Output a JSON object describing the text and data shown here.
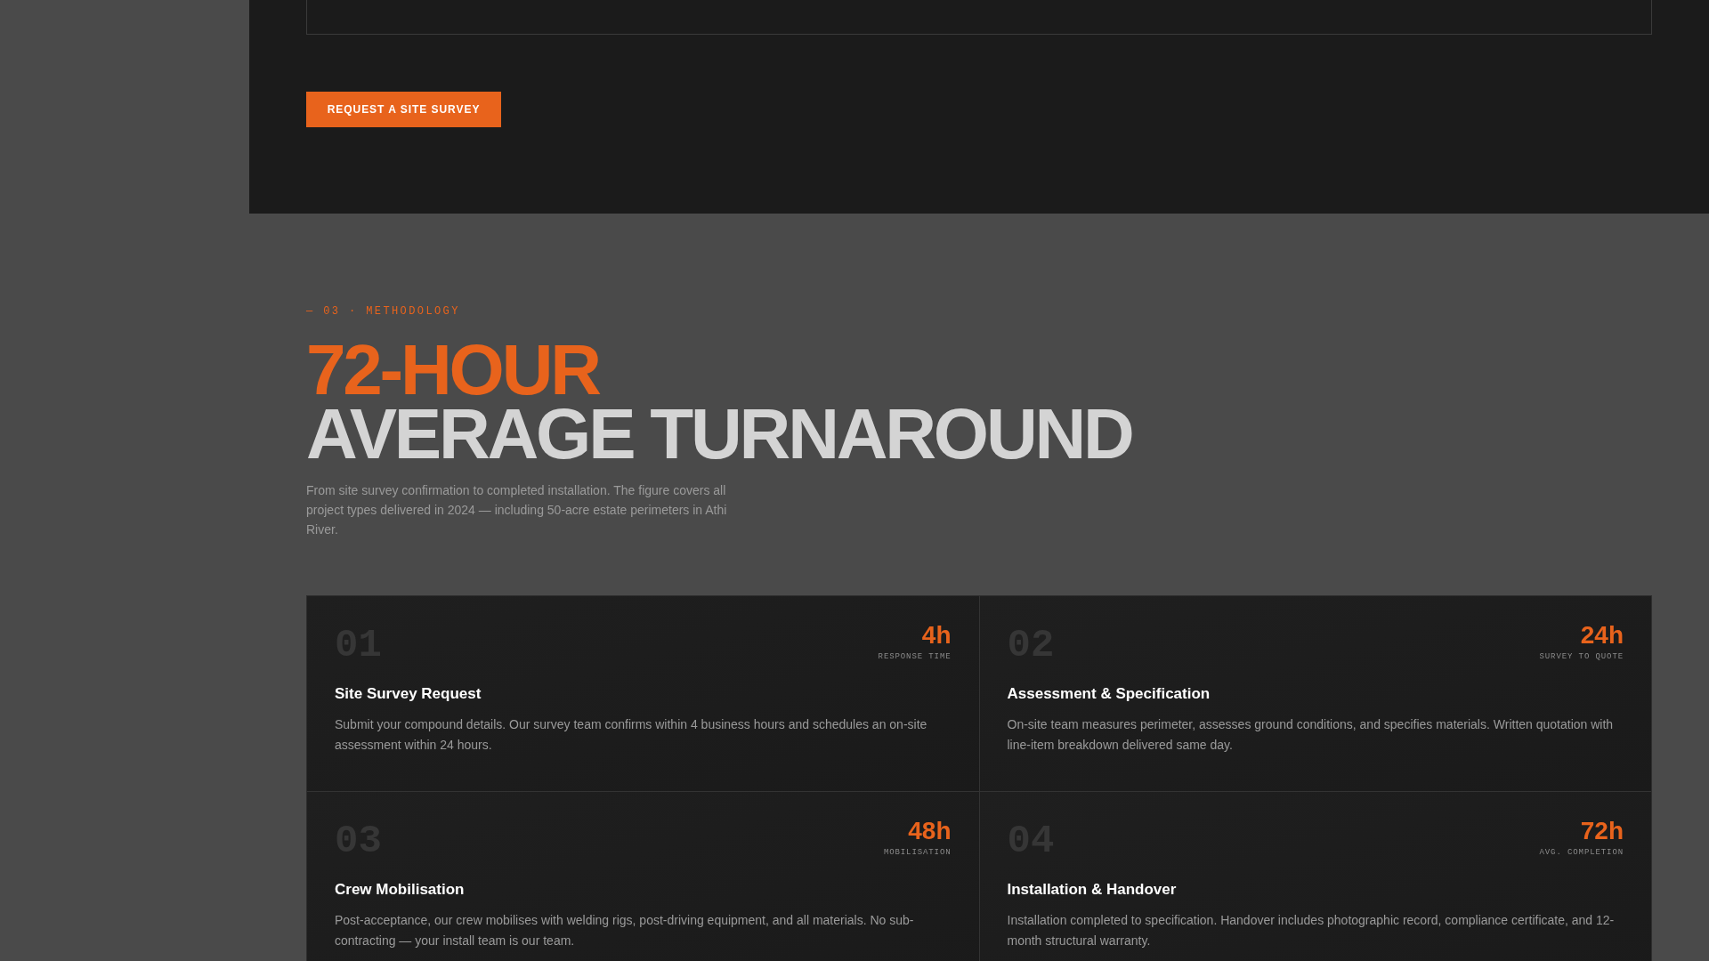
{
  "cta_button": {
    "label": "REQUEST A SITE SURVEY"
  },
  "methodology": {
    "eyebrow": "— 03 · METHODOLOGY",
    "heading_accent": "72-HOUR",
    "heading": "AVERAGE TURNAROUND",
    "description": "From site survey confirmation to completed installation. The figure covers all project types delivered in 2024 — including 50-acre estate perimeters in Athi River."
  },
  "steps": [
    {
      "number": "01",
      "time": "4h",
      "time_label": "RESPONSE TIME",
      "title": "Site Survey Request",
      "description": "Submit your compound details. Our survey team confirms within 4 business hours and schedules an on-site assessment within 24 hours."
    },
    {
      "number": "02",
      "time": "24h",
      "time_label": "SURVEY TO QUOTE",
      "title": "Assessment & Specification",
      "description": "On-site team measures perimeter, assesses ground conditions, and specifies materials. Written quotation with line-item breakdown delivered same day."
    },
    {
      "number": "03",
      "time": "48h",
      "time_label": "MOBILISATION",
      "title": "Crew Mobilisation",
      "description": "Post-acceptance, our crew mobilises with welding rigs, post-driving equipment, and all materials. No sub-contracting — your install team is our team."
    },
    {
      "number": "04",
      "time": "72h",
      "time_label": "AVG. COMPLETION",
      "title": "Installation & Handover",
      "description": "Installation completed to specification. Handover includes photographic record, compliance certificate, and 12-month structural warranty."
    }
  ]
}
